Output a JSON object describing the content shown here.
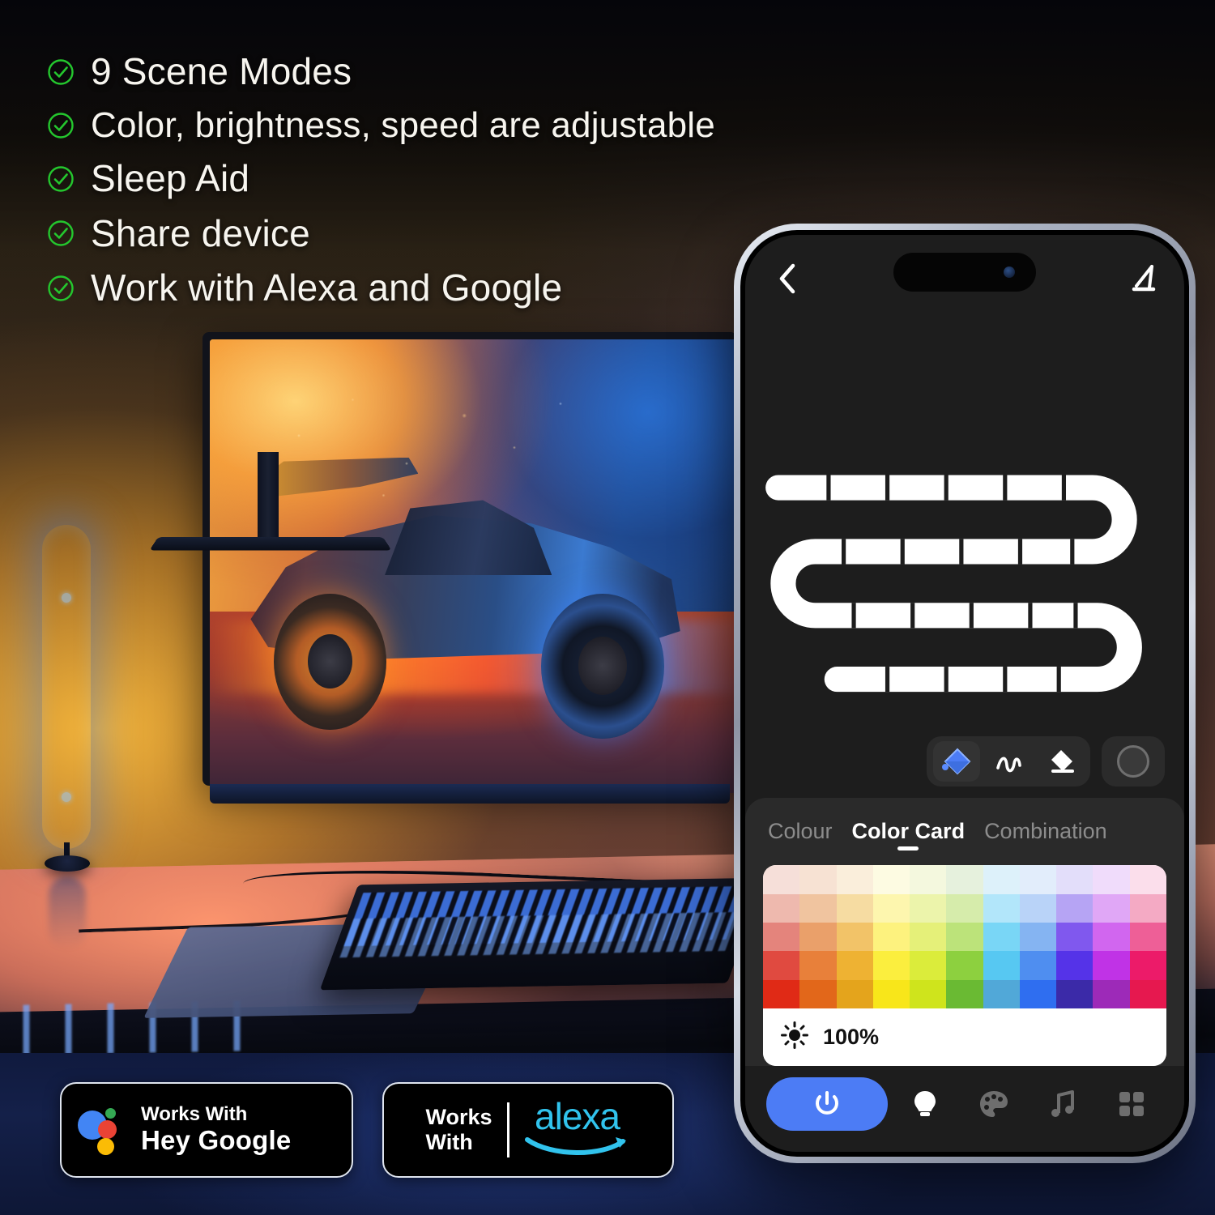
{
  "features": [
    {
      "label": "9 Scene Modes",
      "icon": "check-circle-icon"
    },
    {
      "label": "Color, brightness, speed are adjustable",
      "icon": "check-circle-icon"
    },
    {
      "label": "Sleep Aid",
      "icon": "check-circle-icon"
    },
    {
      "label": "Share device",
      "icon": "check-circle-icon"
    },
    {
      "label": "Work with Alexa and Google",
      "icon": "check-circle-icon"
    }
  ],
  "badges": {
    "google": {
      "works_label": "Works With",
      "brand_label": "Hey Google",
      "icon": "google-assistant-dots-icon"
    },
    "alexa": {
      "works_label_line1": "Works",
      "works_label_line2": "With",
      "brand_label": "alexa",
      "icon": "amazon-smile-icon"
    }
  },
  "phone": {
    "topbar": {
      "back_icon": "chevron-left-icon",
      "edit_icon": "edit-pencil-icon"
    },
    "tools": {
      "items": [
        {
          "name": "paint-bucket-tool",
          "icon": "paint-bucket-icon",
          "active": true
        },
        {
          "name": "brush-tool",
          "icon": "brush-icon",
          "active": false
        },
        {
          "name": "eraser-tool",
          "icon": "eraser-icon",
          "active": false
        }
      ],
      "size_button": {
        "name": "brush-size-button",
        "icon": "circle-icon"
      }
    },
    "tabs": [
      {
        "label": "Colour",
        "active": false
      },
      {
        "label": "Color Card",
        "active": true
      },
      {
        "label": "Combination",
        "active": false
      }
    ],
    "brightness": {
      "icon": "brightness-sun-icon",
      "value": "100%"
    },
    "nav": [
      {
        "name": "power-button",
        "icon": "power-icon",
        "active": true,
        "accent": "#4c7cf5"
      },
      {
        "name": "nav-light",
        "icon": "bulb-icon",
        "active": true
      },
      {
        "name": "nav-scene",
        "icon": "palette-icon",
        "active": false
      },
      {
        "name": "nav-music",
        "icon": "music-note-icon",
        "active": false
      },
      {
        "name": "nav-more",
        "icon": "grid-icon",
        "active": false
      }
    ],
    "color_card": {
      "columns": 11,
      "rows": 5,
      "grid": [
        [
          "#f6dfd9",
          "#f7e2d3",
          "#faeedb",
          "#fdfbe2",
          "#f4f8de",
          "#e6f1dd",
          "#ddf1fa",
          "#e2edfb",
          "#e3defa",
          "#f0dcfb",
          "#fbdeeb"
        ],
        [
          "#eeb9ae",
          "#f0c49f",
          "#f6dca2",
          "#fdf6ae",
          "#ecf4ab",
          "#d6ecab",
          "#b2e6fa",
          "#b9d3f8",
          "#b6a4f4",
          "#e0a7f6",
          "#f4aac4"
        ],
        [
          "#e4847c",
          "#eaa06a",
          "#f2c368",
          "#fdf27e",
          "#e5f079",
          "#bce37a",
          "#79d6f6",
          "#85b4f2",
          "#8058ee",
          "#d166ef",
          "#ee5f97"
        ],
        [
          "#e04a40",
          "#e8803a",
          "#eeb233",
          "#fbee3e",
          "#dbec3b",
          "#8dd03f",
          "#57c8f2",
          "#4f8ef0",
          "#5533e8",
          "#c033e6",
          "#ec1b69"
        ],
        [
          "#e02a16",
          "#e2671a",
          "#e4a41c",
          "#f8e61a",
          "#cfe41c",
          "#6aba33",
          "#51a8d8",
          "#2f6ef0",
          "#3b2aa8",
          "#9d2ab8",
          "#e6184f"
        ]
      ]
    },
    "strip": {
      "name": "led-strip-canvas",
      "color": "#ffffff",
      "segments": 22
    }
  }
}
